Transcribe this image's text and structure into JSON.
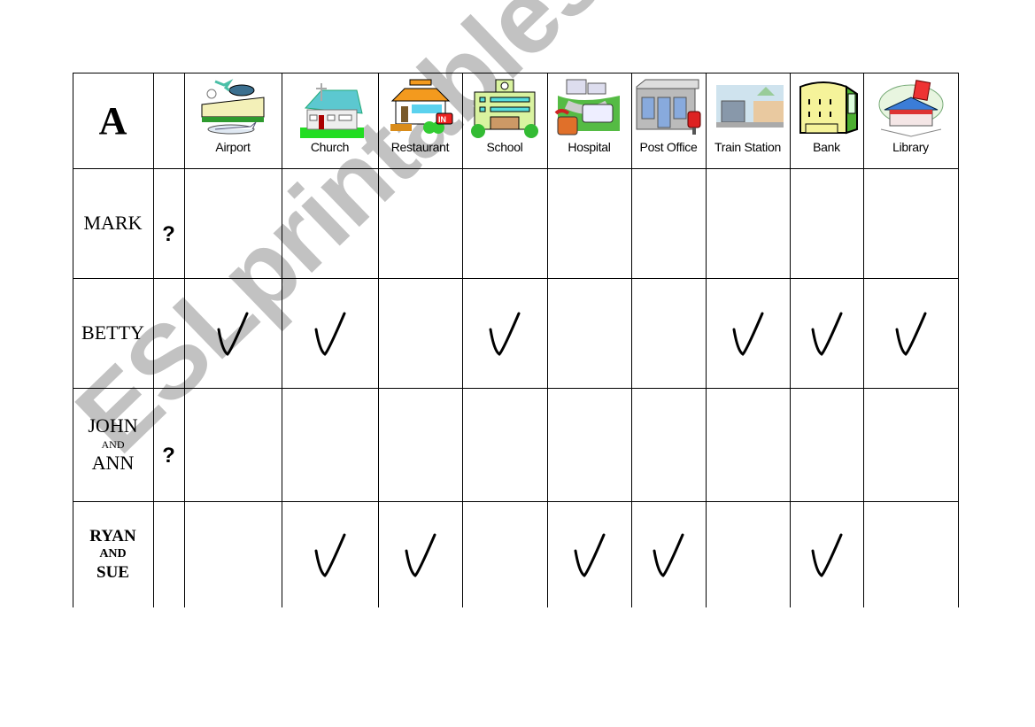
{
  "worksheet": {
    "corner_label": "A",
    "columns": [
      {
        "label": "Airport",
        "icon": "airport-icon"
      },
      {
        "label": "Church",
        "icon": "church-icon"
      },
      {
        "label": "Restaurant",
        "icon": "restaurant-icon"
      },
      {
        "label": "School",
        "icon": "school-icon"
      },
      {
        "label": "Hospital",
        "icon": "hospital-icon"
      },
      {
        "label": "Post Office",
        "icon": "post-office-icon"
      },
      {
        "label": "Train Station",
        "icon": "train-station-icon"
      },
      {
        "label": "Bank",
        "icon": "bank-icon"
      },
      {
        "label": "Library",
        "icon": "library-icon"
      }
    ],
    "rows": [
      {
        "name_lines": [
          "MARK"
        ],
        "question": "?",
        "checks": [
          false,
          false,
          false,
          false,
          false,
          false,
          false,
          false,
          false
        ]
      },
      {
        "name_lines": [
          "BETTY"
        ],
        "question": "",
        "checks": [
          true,
          true,
          false,
          true,
          false,
          false,
          true,
          true,
          true
        ]
      },
      {
        "name_lines": [
          "JOHN",
          "AND",
          "ANN"
        ],
        "question": "?",
        "checks": [
          false,
          false,
          false,
          false,
          false,
          false,
          false,
          false,
          false
        ]
      },
      {
        "name_lines": [
          "RYAN",
          "AND",
          "SUE"
        ],
        "question": "",
        "checks": [
          false,
          true,
          true,
          false,
          true,
          true,
          false,
          true,
          false
        ]
      }
    ]
  },
  "watermark": "ESLprintables.com"
}
